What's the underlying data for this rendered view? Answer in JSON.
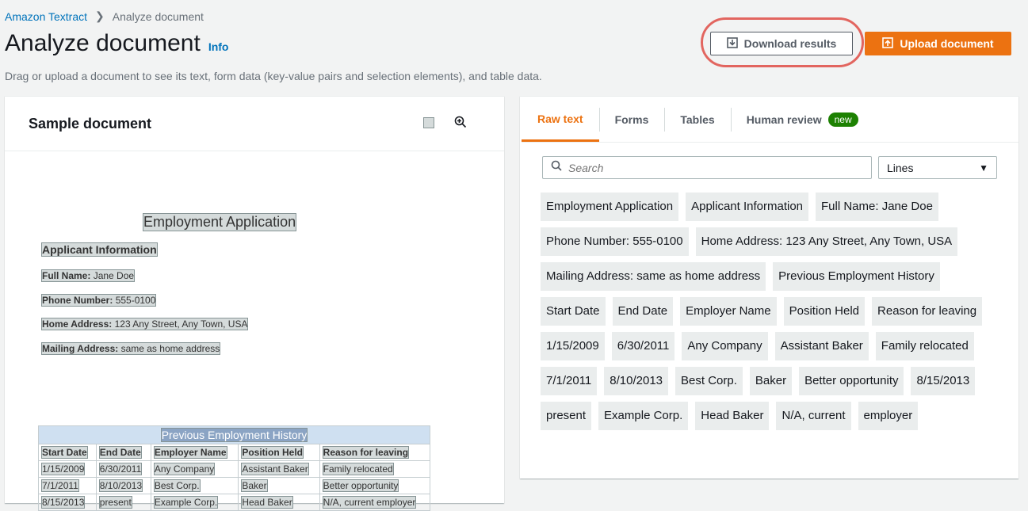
{
  "breadcrumb": {
    "root": "Amazon Textract",
    "current": "Analyze document"
  },
  "header": {
    "title": "Analyze document",
    "info": "Info",
    "subtitle": "Drag or upload a document to see its text, form data (key-value pairs and selection elements), and table data."
  },
  "actions": {
    "download": "Download results",
    "upload": "Upload document",
    "accent": "#ec7211",
    "highlight": "#e2655f"
  },
  "left_panel": {
    "heading": "Sample document",
    "document": {
      "title": "Employment Application",
      "section": "Applicant Information",
      "fields": [
        {
          "key": "Full Name:",
          "value": "Jane Doe"
        },
        {
          "key": "Phone Number:",
          "value": "555-0100"
        },
        {
          "key": "Home Address:",
          "value": "123 Any Street, Any Town, USA"
        },
        {
          "key": "Mailing Address:",
          "value": "same as home address"
        }
      ],
      "table_caption": "Previous Employment History",
      "table_headers": [
        "Start Date",
        "End Date",
        "Employer Name",
        "Position Held",
        "Reason for leaving"
      ],
      "table_rows": [
        [
          "1/15/2009",
          "6/30/2011",
          "Any Company",
          "Assistant Baker",
          "Family relocated"
        ],
        [
          "7/1/2011",
          "8/10/2013",
          "Best Corp.",
          "Baker",
          "Better opportunity"
        ],
        [
          "8/15/2013",
          "present",
          "Example Corp.",
          "Head Baker",
          "N/A, current employer"
        ]
      ]
    }
  },
  "right_panel": {
    "tabs": [
      "Raw text",
      "Forms",
      "Tables",
      "Human review"
    ],
    "badge": "new",
    "search_placeholder": "Search",
    "select_value": "Lines",
    "lines": [
      "Employment Application",
      "Applicant Information",
      "Full Name: Jane Doe",
      "Phone Number: 555-0100",
      "Home Address: 123 Any Street, Any Town, USA",
      "Mailing Address: same as home address",
      "Previous Employment History",
      "Start Date",
      "End Date",
      "Employer Name",
      "Position Held",
      "Reason for leaving",
      "1/15/2009",
      "6/30/2011",
      "Any Company",
      "Assistant Baker",
      "Family relocated",
      "7/1/2011",
      "8/10/2013",
      "Best Corp.",
      "Baker",
      "Better opportunity",
      "8/15/2013",
      "present",
      "Example Corp.",
      "Head Baker",
      "N/A, current",
      "employer"
    ]
  }
}
